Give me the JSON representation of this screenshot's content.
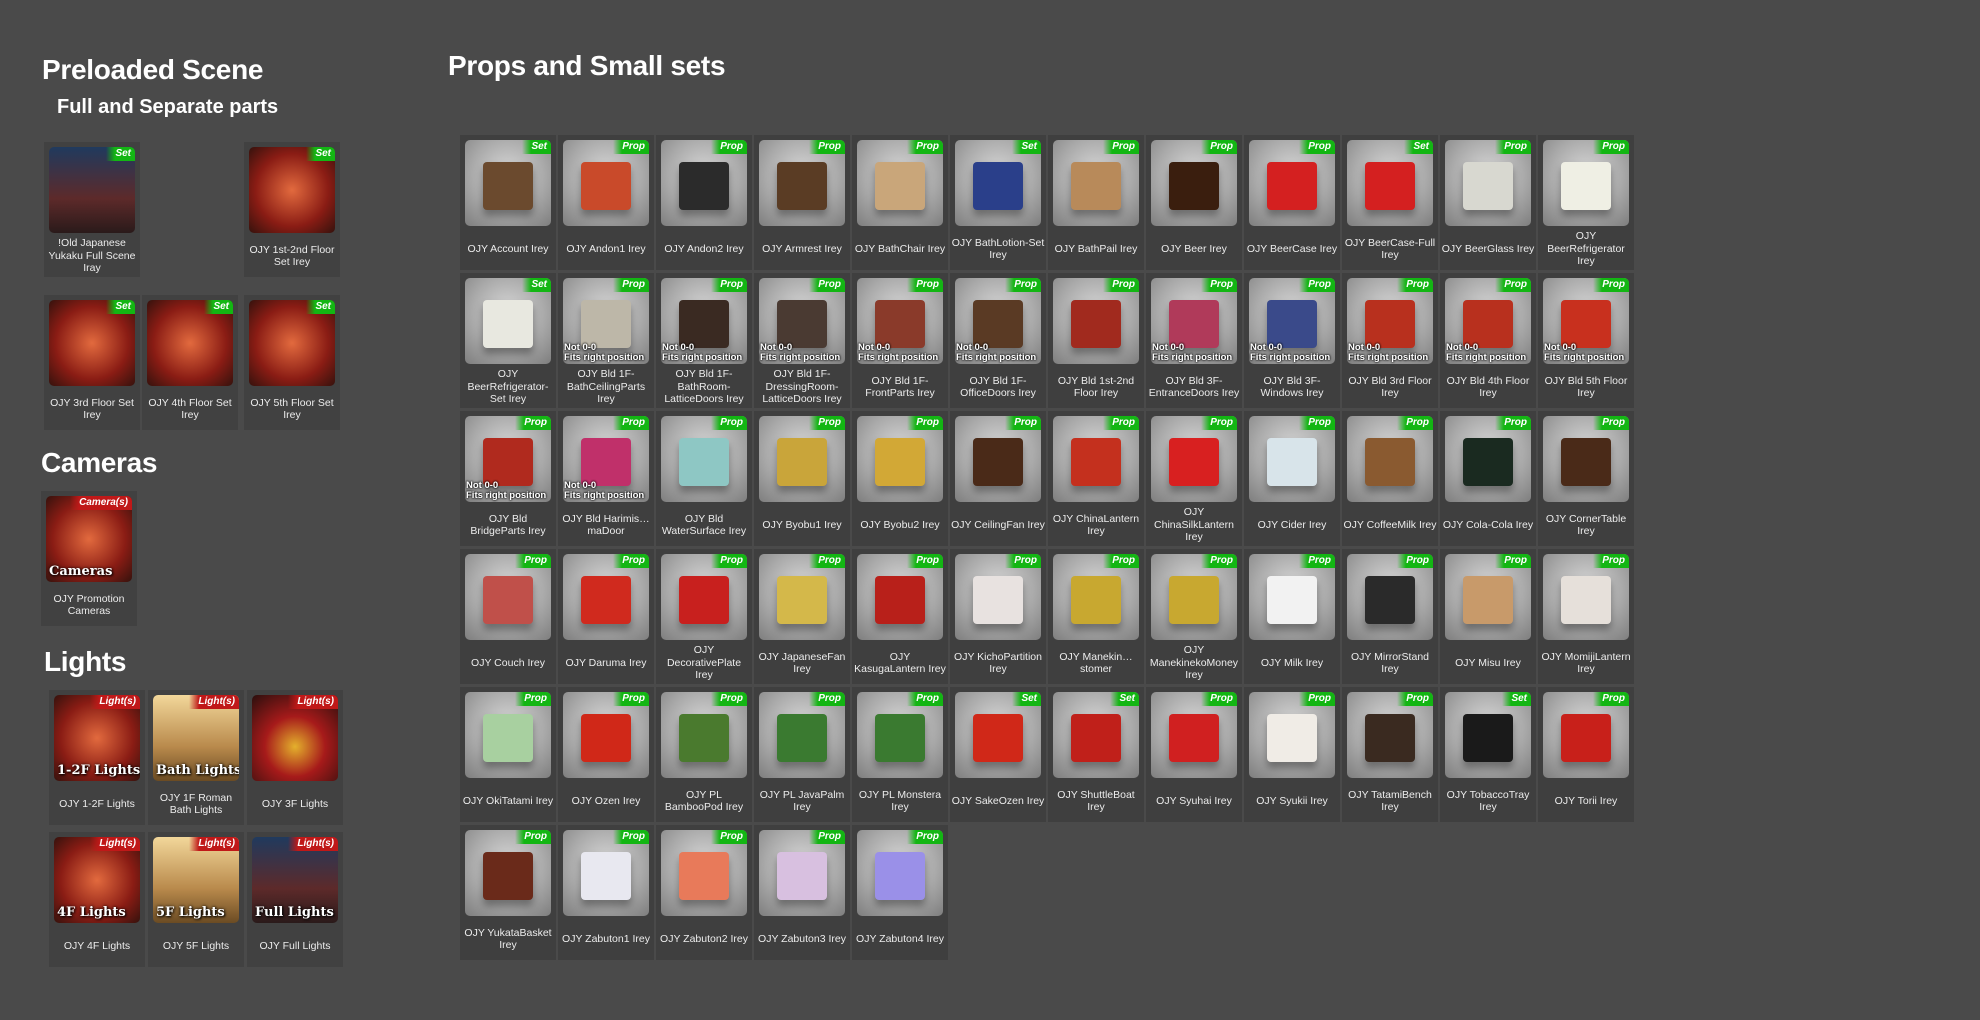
{
  "sections": {
    "preloaded_title": "Preloaded Scene",
    "preloaded_subtitle": "Full and Separate parts",
    "cameras_title": "Cameras",
    "lights_title": "Lights",
    "props_title": "Props and Small sets"
  },
  "warning": {
    "line1": "Not 0-0",
    "line2": "Fits right position"
  },
  "preloaded": [
    {
      "label": "!Old Japanese Yukaku Full Scene Iray",
      "badge": "Set",
      "scene": "night"
    },
    {
      "label": "OJY 1st-2nd Floor Set Irey",
      "badge": "Set",
      "scene": "red"
    },
    {
      "label": "OJY 3rd Floor Set Irey",
      "badge": "Set",
      "scene": "red"
    },
    {
      "label": "OJY 4th Floor Set Irey",
      "badge": "Set",
      "scene": "red"
    },
    {
      "label": "OJY 5th Floor Set Irey",
      "badge": "Set",
      "scene": "red"
    }
  ],
  "cameras": [
    {
      "label": "OJY Promotion Cameras",
      "badge": "Camera(s)",
      "overlay": "Cameras",
      "scene": "red"
    }
  ],
  "lights": [
    {
      "label": "OJY 1-2F Lights",
      "badge": "Light(s)",
      "overlay": "1-2F Lights",
      "scene": "red"
    },
    {
      "label": "OJY 1F Roman Bath Lights",
      "badge": "Light(s)",
      "overlay": "Bath Lights",
      "scene": "warm"
    },
    {
      "label": "OJY 3F Lights",
      "badge": "Light(s)",
      "overlay": "",
      "scene": "ruby"
    },
    {
      "label": "OJY 4F Lights",
      "badge": "Light(s)",
      "overlay": "4F Lights",
      "scene": "red"
    },
    {
      "label": "OJY 5F Lights",
      "badge": "Light(s)",
      "overlay": "5F Lights",
      "scene": "warm"
    },
    {
      "label": "OJY Full Lights",
      "badge": "Light(s)",
      "overlay": "Full Lights",
      "scene": "night"
    }
  ],
  "props": [
    {
      "label": "OJY Account Irey",
      "badge": "Set",
      "color": "#6b4a2e"
    },
    {
      "label": "OJY Andon1 Irey",
      "badge": "Prop",
      "color": "#c94a2a"
    },
    {
      "label": "OJY Andon2 Irey",
      "badge": "Prop",
      "color": "#2b2b2b"
    },
    {
      "label": "OJY Armrest Irey",
      "badge": "Prop",
      "color": "#5a3c24"
    },
    {
      "label": "OJY BathChair Irey",
      "badge": "Prop",
      "color": "#c9a67a"
    },
    {
      "label": "OJY BathLotion-Set Irey",
      "badge": "Set",
      "color": "#2a3f8a"
    },
    {
      "label": "OJY BathPail Irey",
      "badge": "Prop",
      "color": "#b88a5a"
    },
    {
      "label": "OJY Beer Irey",
      "badge": "Prop",
      "color": "#3a1e0e"
    },
    {
      "label": "OJY BeerCase Irey",
      "badge": "Prop",
      "color": "#d42020"
    },
    {
      "label": "OJY BeerCase-Full Irey",
      "badge": "Set",
      "color": "#d42020"
    },
    {
      "label": "OJY BeerGlass Irey",
      "badge": "Prop",
      "color": "#d8d8d0"
    },
    {
      "label": "OJY BeerRefrigerator Irey",
      "badge": "Prop",
      "color": "#efefe4"
    },
    {
      "label": "OJY BeerRefrigerator-Set Irey",
      "badge": "Set",
      "color": "#e8e8e0"
    },
    {
      "label": "OJY Bld 1F-BathCeilingParts Irey",
      "badge": "Prop",
      "color": "#bdb7a8",
      "warn": true
    },
    {
      "label": "OJY Bld 1F-BathRoom-LatticeDoors Irey",
      "badge": "Prop",
      "color": "#3a2a22",
      "warn": true
    },
    {
      "label": "OJY Bld 1F-DressingRoom-LatticeDoors Irey",
      "badge": "Prop",
      "color": "#4a3a32",
      "warn": true
    },
    {
      "label": "OJY Bld 1F-FrontParts Irey",
      "badge": "Prop",
      "color": "#8a3a2a",
      "warn": true
    },
    {
      "label": "OJY Bld 1F-OfficeDoors Irey",
      "badge": "Prop",
      "color": "#5a3a24",
      "warn": true
    },
    {
      "label": "OJY Bld 1st-2nd Floor Irey",
      "badge": "Prop",
      "color": "#a12a1e"
    },
    {
      "label": "OJY Bld 3F-EntranceDoors Irey",
      "badge": "Prop",
      "color": "#b03a5a",
      "warn": true
    },
    {
      "label": "OJY Bld 3F-Windows Irey",
      "badge": "Prop",
      "color": "#3a4a8a",
      "warn": true
    },
    {
      "label": "OJY Bld 3rd Floor Irey",
      "badge": "Prop",
      "color": "#b8301e",
      "warn": true
    },
    {
      "label": "OJY Bld 4th Floor Irey",
      "badge": "Prop",
      "color": "#b8301e",
      "warn": true
    },
    {
      "label": "OJY Bld 5th Floor Irey",
      "badge": "Prop",
      "color": "#c8301e",
      "warn": true
    },
    {
      "label": "OJY Bld BridgeParts Irey",
      "badge": "Prop",
      "color": "#b02a1e",
      "warn": true
    },
    {
      "label": "OJY Bld Harimis…maDoor",
      "badge": "Prop",
      "color": "#c0306a",
      "warn": true
    },
    {
      "label": "OJY Bld WaterSurface Irey",
      "badge": "Prop",
      "color": "#8ec7c4"
    },
    {
      "label": "OJY Byobu1 Irey",
      "badge": "Prop",
      "color": "#c9a53a"
    },
    {
      "label": "OJY Byobu2 Irey",
      "badge": "Prop",
      "color": "#d2a836"
    },
    {
      "label": "OJY CeilingFan Irey",
      "badge": "Prop",
      "color": "#4a2a18"
    },
    {
      "label": "OJY ChinaLantern Irey",
      "badge": "Prop",
      "color": "#c4301e"
    },
    {
      "label": "OJY ChinaSilkLantern Irey",
      "badge": "Prop",
      "color": "#d82020"
    },
    {
      "label": "OJY Cider Irey",
      "badge": "Prop",
      "color": "#d8e4ea"
    },
    {
      "label": "OJY CoffeeMilk Irey",
      "badge": "Prop",
      "color": "#8a5a30"
    },
    {
      "label": "OJY Cola-Cola Irey",
      "badge": "Prop",
      "color": "#1a2a20"
    },
    {
      "label": "OJY CornerTable Irey",
      "badge": "Prop",
      "color": "#4a2a18"
    },
    {
      "label": "OJY Couch Irey",
      "badge": "Prop",
      "color": "#c0504a"
    },
    {
      "label": "OJY Daruma Irey",
      "badge": "Prop",
      "color": "#d02a1e"
    },
    {
      "label": "OJY DecorativePlate Irey",
      "badge": "Prop",
      "color": "#c8201e"
    },
    {
      "label": "OJY JapaneseFan Irey",
      "badge": "Prop",
      "color": "#d4b84a"
    },
    {
      "label": "OJY KasugaLantern Irey",
      "badge": "Prop",
      "color": "#b8201a"
    },
    {
      "label": "OJY KichoPartition Irey",
      "badge": "Prop",
      "color": "#e8e2e0"
    },
    {
      "label": "OJY Manekin…stomer",
      "badge": "Prop",
      "color": "#c8a830"
    },
    {
      "label": "OJY ManekinekoMoney Irey",
      "badge": "Prop",
      "color": "#c8a830"
    },
    {
      "label": "OJY Milk Irey",
      "badge": "Prop",
      "color": "#f2f2f2"
    },
    {
      "label": "OJY MirrorStand Irey",
      "badge": "Prop",
      "color": "#2a2a2a"
    },
    {
      "label": "OJY Misu Irey",
      "badge": "Prop",
      "color": "#c89a6a"
    },
    {
      "label": "OJY MomijiLantern Irey",
      "badge": "Prop",
      "color": "#e6e0da"
    },
    {
      "label": "OJY OkiTatami Irey",
      "badge": "Prop",
      "color": "#a8d0a0"
    },
    {
      "label": "OJY Ozen Irey",
      "badge": "Prop",
      "color": "#d02818"
    },
    {
      "label": "OJY PL BambooPod Irey",
      "badge": "Prop",
      "color": "#4a7a2e"
    },
    {
      "label": "OJY PL JavaPalm Irey",
      "badge": "Prop",
      "color": "#3a7a30"
    },
    {
      "label": "OJY PL Monstera Irey",
      "badge": "Prop",
      "color": "#3a7a30"
    },
    {
      "label": "OJY SakeOzen Irey",
      "badge": "Set",
      "color": "#d02818"
    },
    {
      "label": "OJY ShuttleBoat Irey",
      "badge": "Set",
      "color": "#c0201a"
    },
    {
      "label": "OJY Syuhai Irey",
      "badge": "Prop",
      "color": "#d02020"
    },
    {
      "label": "OJY Syukii Irey",
      "badge": "Prop",
      "color": "#f0ece6"
    },
    {
      "label": "OJY TatamiBench Irey",
      "badge": "Prop",
      "color": "#3a2a20"
    },
    {
      "label": "OJY TobaccoTray Irey",
      "badge": "Set",
      "color": "#1a1a1a"
    },
    {
      "label": "OJY Torii Irey",
      "badge": "Prop",
      "color": "#c8201a"
    },
    {
      "label": "OJY YukataBasket Irey",
      "badge": "Prop",
      "color": "#6a2a1a"
    },
    {
      "label": "OJY Zabuton1 Irey",
      "badge": "Prop",
      "color": "#e8e8f0"
    },
    {
      "label": "OJY Zabuton2 Irey",
      "badge": "Prop",
      "color": "#e87a5a"
    },
    {
      "label": "OJY Zabuton3 Irey",
      "badge": "Prop",
      "color": "#d8c0e0"
    },
    {
      "label": "OJY Zabuton4 Irey",
      "badge": "Prop",
      "color": "#9a90e8"
    }
  ]
}
